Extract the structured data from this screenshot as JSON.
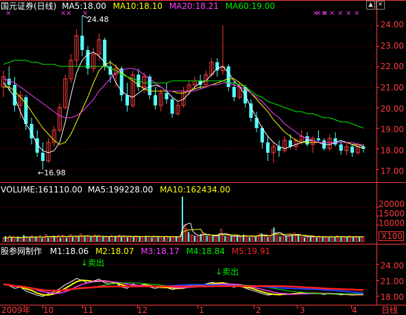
{
  "chart_data": {
    "type": "candlestick",
    "main": {
      "title": "国元证券(日线)",
      "ma": [
        {
          "label": "MA5:18.00",
          "color": "#ffffff",
          "values": [
            21.2,
            20.9,
            20.5,
            19.8,
            19.2,
            18.8,
            18.2,
            17.9,
            17.8,
            17.9,
            18.3,
            19.3,
            20.6,
            21.7,
            22.3,
            22.6,
            22.7,
            22.5,
            22.2,
            21.8,
            21.2,
            20.8,
            20.6,
            20.5,
            20.7,
            20.9,
            21.0,
            21.1,
            21.0,
            20.8,
            20.5,
            20.3,
            20.4,
            20.7,
            21.0,
            21.2,
            21.3,
            21.6,
            21.9,
            22.0,
            21.7,
            21.3,
            21.0,
            20.6,
            20.0,
            19.5,
            19.0,
            18.6,
            18.3,
            18.1,
            18.0,
            18.1,
            18.2,
            18.3,
            18.4,
            18.4,
            18.3,
            18.2,
            18.2,
            18.3,
            18.4,
            18.3,
            18.2,
            18.1,
            18.0
          ]
        },
        {
          "label": "MA10:18.10",
          "color": "#ffff00",
          "values": [
            21.0,
            21.0,
            20.8,
            20.5,
            20.2,
            19.8,
            19.4,
            19.0,
            18.7,
            18.4,
            18.2,
            18.3,
            18.7,
            19.3,
            19.9,
            20.5,
            21.2,
            21.8,
            22.1,
            22.2,
            22.0,
            21.7,
            21.5,
            21.3,
            21.1,
            20.9,
            20.8,
            20.8,
            20.8,
            20.8,
            20.8,
            20.7,
            20.7,
            20.8,
            20.9,
            21.0,
            21.0,
            21.1,
            21.2,
            21.3,
            21.4,
            21.4,
            21.2,
            21.0,
            20.7,
            20.4,
            20.1,
            19.8,
            19.4,
            19.1,
            18.8,
            18.6,
            18.4,
            18.3,
            18.3,
            18.3,
            18.3,
            18.3,
            18.3,
            18.3,
            18.3,
            18.3,
            18.2,
            18.2,
            18.1
          ]
        },
        {
          "label": "MA20:18.21",
          "color": "#ff40ff",
          "values": [
            21.4,
            21.3,
            21.2,
            21.0,
            20.8,
            20.6,
            20.4,
            20.2,
            20.0,
            19.8,
            19.6,
            19.5,
            19.5,
            19.6,
            19.8,
            20.1,
            20.4,
            20.8,
            21.1,
            21.4,
            21.7,
            21.8,
            21.9,
            21.9,
            21.8,
            21.6,
            21.4,
            21.2,
            21.0,
            20.8,
            20.8,
            20.8,
            20.8,
            20.8,
            20.8,
            20.9,
            21.0,
            21.1,
            21.1,
            21.2,
            21.2,
            21.1,
            21.0,
            20.9,
            20.7,
            20.5,
            20.3,
            20.0,
            19.7,
            19.5,
            19.2,
            19.0,
            18.8,
            18.6,
            18.5,
            18.4,
            18.3,
            18.3,
            18.3,
            18.3,
            18.3,
            18.3,
            18.3,
            18.2,
            18.2
          ]
        },
        {
          "label": "MA60:19.00",
          "color": "#00ee00",
          "values": [
            22.1,
            22.2,
            22.3,
            22.3,
            22.3,
            22.2,
            22.2,
            22.1,
            22.1,
            22.1,
            22.0,
            22.0,
            22.0,
            22.0,
            22.0,
            22.0,
            22.0,
            22.0,
            22.0,
            21.9,
            21.8,
            21.6,
            21.5,
            21.4,
            21.3,
            21.2,
            21.2,
            21.2,
            21.2,
            21.2,
            21.3,
            21.3,
            21.3,
            21.3,
            21.3,
            21.3,
            21.3,
            21.3,
            21.3,
            21.3,
            21.2,
            21.2,
            21.1,
            21.0,
            20.8,
            20.6,
            20.5,
            20.3,
            20.2,
            20.1,
            20.0,
            19.9,
            19.8,
            19.8,
            19.7,
            19.7,
            19.6,
            19.5,
            19.5,
            19.4,
            19.3,
            19.3,
            19.2,
            19.1,
            19.0
          ]
        }
      ],
      "yticks": [
        "24.00",
        "23.00",
        "22.00",
        "21.00",
        "20.00",
        "19.00",
        "18.00",
        "17.00"
      ],
      "ylim": [
        16.5,
        24.7
      ],
      "high_label": "24.48",
      "low_label": "16.98",
      "candles": [
        {
          "o": 21.0,
          "h": 21.8,
          "l": 20.5,
          "c": 21.5
        },
        {
          "o": 21.4,
          "h": 22.0,
          "l": 20.8,
          "c": 21.1
        },
        {
          "o": 21.1,
          "h": 21.5,
          "l": 19.8,
          "c": 20.1
        },
        {
          "o": 20.1,
          "h": 20.8,
          "l": 19.5,
          "c": 20.6
        },
        {
          "o": 20.5,
          "h": 20.6,
          "l": 18.9,
          "c": 19.2
        },
        {
          "o": 19.2,
          "h": 19.5,
          "l": 18.2,
          "c": 18.5
        },
        {
          "o": 18.5,
          "h": 18.9,
          "l": 17.6,
          "c": 17.8
        },
        {
          "o": 17.8,
          "h": 18.3,
          "l": 16.98,
          "c": 17.4
        },
        {
          "o": 17.4,
          "h": 18.5,
          "l": 17.3,
          "c": 18.3
        },
        {
          "o": 18.3,
          "h": 19.1,
          "l": 18.1,
          "c": 18.9
        },
        {
          "o": 18.9,
          "h": 20.2,
          "l": 18.8,
          "c": 20.0
        },
        {
          "o": 20.0,
          "h": 21.6,
          "l": 19.9,
          "c": 21.4
        },
        {
          "o": 21.4,
          "h": 22.6,
          "l": 21.2,
          "c": 22.3
        },
        {
          "o": 22.3,
          "h": 23.8,
          "l": 22.0,
          "c": 23.5
        },
        {
          "o": 23.5,
          "h": 24.48,
          "l": 22.5,
          "c": 22.8
        },
        {
          "o": 22.8,
          "h": 23.0,
          "l": 21.6,
          "c": 21.9
        },
        {
          "o": 21.9,
          "h": 22.9,
          "l": 21.7,
          "c": 22.6
        },
        {
          "o": 22.6,
          "h": 23.6,
          "l": 22.3,
          "c": 23.3
        },
        {
          "o": 23.3,
          "h": 23.4,
          "l": 21.8,
          "c": 22.0
        },
        {
          "o": 22.0,
          "h": 22.3,
          "l": 21.2,
          "c": 21.6
        },
        {
          "o": 21.6,
          "h": 22.1,
          "l": 21.0,
          "c": 21.9
        },
        {
          "o": 21.9,
          "h": 22.0,
          "l": 20.3,
          "c": 20.6
        },
        {
          "o": 20.6,
          "h": 21.2,
          "l": 19.8,
          "c": 20.1
        },
        {
          "o": 20.1,
          "h": 21.8,
          "l": 20.0,
          "c": 21.6
        },
        {
          "o": 21.6,
          "h": 21.9,
          "l": 20.8,
          "c": 21.0
        },
        {
          "o": 21.0,
          "h": 21.7,
          "l": 20.7,
          "c": 21.5
        },
        {
          "o": 21.5,
          "h": 21.6,
          "l": 20.4,
          "c": 20.6
        },
        {
          "o": 20.6,
          "h": 21.0,
          "l": 19.9,
          "c": 20.1
        },
        {
          "o": 20.1,
          "h": 20.9,
          "l": 19.8,
          "c": 20.7
        },
        {
          "o": 20.7,
          "h": 21.2,
          "l": 20.2,
          "c": 20.4
        },
        {
          "o": 20.4,
          "h": 20.5,
          "l": 19.5,
          "c": 19.7
        },
        {
          "o": 19.7,
          "h": 20.3,
          "l": 19.6,
          "c": 20.1
        },
        {
          "o": 20.1,
          "h": 21.0,
          "l": 20.0,
          "c": 20.8
        },
        {
          "o": 20.8,
          "h": 21.3,
          "l": 20.6,
          "c": 21.1
        },
        {
          "o": 21.1,
          "h": 21.5,
          "l": 20.9,
          "c": 21.3
        },
        {
          "o": 21.3,
          "h": 21.6,
          "l": 20.9,
          "c": 21.1
        },
        {
          "o": 21.1,
          "h": 21.8,
          "l": 21.0,
          "c": 21.6
        },
        {
          "o": 21.6,
          "h": 22.4,
          "l": 21.5,
          "c": 22.2
        },
        {
          "o": 22.2,
          "h": 22.4,
          "l": 21.5,
          "c": 21.8
        },
        {
          "o": 21.8,
          "h": 24.0,
          "l": 21.6,
          "c": 22.0
        },
        {
          "o": 22.0,
          "h": 22.1,
          "l": 20.8,
          "c": 21.0
        },
        {
          "o": 21.0,
          "h": 21.3,
          "l": 20.3,
          "c": 20.5
        },
        {
          "o": 20.5,
          "h": 21.2,
          "l": 20.4,
          "c": 21.0
        },
        {
          "o": 21.0,
          "h": 21.1,
          "l": 20.0,
          "c": 20.2
        },
        {
          "o": 20.2,
          "h": 20.4,
          "l": 19.3,
          "c": 19.5
        },
        {
          "o": 19.5,
          "h": 19.8,
          "l": 18.8,
          "c": 19.0
        },
        {
          "o": 19.0,
          "h": 19.1,
          "l": 18.0,
          "c": 18.3
        },
        {
          "o": 18.3,
          "h": 18.6,
          "l": 17.4,
          "c": 17.8
        },
        {
          "o": 17.8,
          "h": 18.3,
          "l": 17.3,
          "c": 18.1
        },
        {
          "o": 18.1,
          "h": 18.4,
          "l": 17.6,
          "c": 17.9
        },
        {
          "o": 17.9,
          "h": 18.6,
          "l": 17.8,
          "c": 18.4
        },
        {
          "o": 18.4,
          "h": 18.7,
          "l": 18.0,
          "c": 18.1
        },
        {
          "o": 18.1,
          "h": 18.5,
          "l": 17.9,
          "c": 18.4
        },
        {
          "o": 18.4,
          "h": 18.9,
          "l": 18.2,
          "c": 18.6
        },
        {
          "o": 18.6,
          "h": 18.8,
          "l": 18.1,
          "c": 18.2
        },
        {
          "o": 18.2,
          "h": 18.6,
          "l": 17.8,
          "c": 18.5
        },
        {
          "o": 18.5,
          "h": 18.9,
          "l": 18.3,
          "c": 18.4
        },
        {
          "o": 18.4,
          "h": 18.5,
          "l": 17.9,
          "c": 18.0
        },
        {
          "o": 18.0,
          "h": 18.7,
          "l": 17.9,
          "c": 18.5
        },
        {
          "o": 18.5,
          "h": 18.8,
          "l": 18.1,
          "c": 18.2
        },
        {
          "o": 18.2,
          "h": 18.4,
          "l": 17.7,
          "c": 17.9
        },
        {
          "o": 17.9,
          "h": 18.3,
          "l": 17.7,
          "c": 18.1
        },
        {
          "o": 18.1,
          "h": 18.2,
          "l": 17.6,
          "c": 17.8
        },
        {
          "o": 17.8,
          "h": 18.3,
          "l": 17.7,
          "c": 18.1
        },
        {
          "o": 18.1,
          "h": 18.2,
          "l": 17.8,
          "c": 18.0
        }
      ]
    },
    "volume": {
      "label": "VOLUME:161110.00",
      "ma5_label": "MA5:199228.00",
      "ma10_label": "MA10:162434.00",
      "yticks": [
        "20000",
        "15000",
        "10000"
      ],
      "unit": "X100",
      "ylim": [
        0,
        28000
      ],
      "values": [
        2000,
        3200,
        1800,
        3500,
        2400,
        2800,
        1600,
        3000,
        2200,
        2600,
        3900,
        2100,
        2700,
        2300,
        3300,
        2500,
        3100,
        1900,
        3600,
        2200,
        2800,
        4200,
        2300,
        3100,
        2700,
        3400,
        2500,
        3800,
        2300,
        3700,
        2900,
        2400,
        3300,
        4100,
        2800,
        3400,
        2600,
        3000,
        4500,
        3300,
        2900,
        3500,
        2700,
        3300,
        2500,
        3900,
        3000,
        3600,
        2400,
        3000,
        2700,
        3200,
        2500,
        3600,
        2900,
        3300,
        2600,
        3800,
        2700,
        3500,
        3000,
        2600,
        3300,
        2900,
        2700,
        3400,
        2800,
        3200,
        2600,
        3000,
        3400,
        2900,
        3100,
        2600,
        3300,
        2900,
        3200,
        2500,
        3000,
        2800,
        3400,
        2700,
        3100,
        2900,
        2500,
        3200,
        2800,
        3300,
        26000,
        10000,
        7800,
        5600,
        4100,
        3900,
        3500,
        3200,
        3600,
        4500,
        5200,
        4300,
        3700,
        3200,
        2900,
        4000,
        3400,
        3700,
        4800,
        7200,
        3900,
        3300,
        2800,
        3700,
        3200,
        2900,
        3800,
        3100,
        2600,
        3400,
        4100,
        3600,
        3000,
        2700,
        3500,
        3200,
        2900,
        3800,
        4500,
        4800,
        3400,
        3100,
        2700,
        2900,
        7000,
        8200,
        4500,
        3600,
        3100,
        4100,
        2800,
        3500,
        3300,
        4400,
        3800,
        5100,
        4200,
        3600,
        3100,
        2800,
        2500,
        3300,
        2900,
        2700,
        3100,
        2800,
        2400,
        3300,
        2700,
        3100,
        2600,
        2900,
        2500,
        3200,
        2800,
        2600,
        3400,
        2900,
        2700,
        3100,
        2500,
        2800,
        3300,
        2700,
        2900,
        2500,
        3200,
        2600,
        3000,
        2800
      ]
    },
    "indicator": {
      "name": "股参网制作",
      "lines": [
        {
          "label": "M1:18.06",
          "color": "#ffffff"
        },
        {
          "label": "M2:18.07",
          "color": "#ffff00"
        },
        {
          "label": "M3:18.17",
          "color": "#ff40ff"
        },
        {
          "label": "M4:18.84",
          "color": "#00ee00"
        },
        {
          "label": "M5:19.91",
          "color": "#ff2020"
        }
      ],
      "yticks": [
        "24.00",
        "21.00",
        "18.00"
      ],
      "sell_labels": [
        "卖出",
        "卖出"
      ]
    },
    "x_axis": {
      "labels": [
        "2009年",
        "10",
        "11",
        "12",
        "1",
        "2",
        "3",
        "4"
      ],
      "period": "日线"
    }
  }
}
